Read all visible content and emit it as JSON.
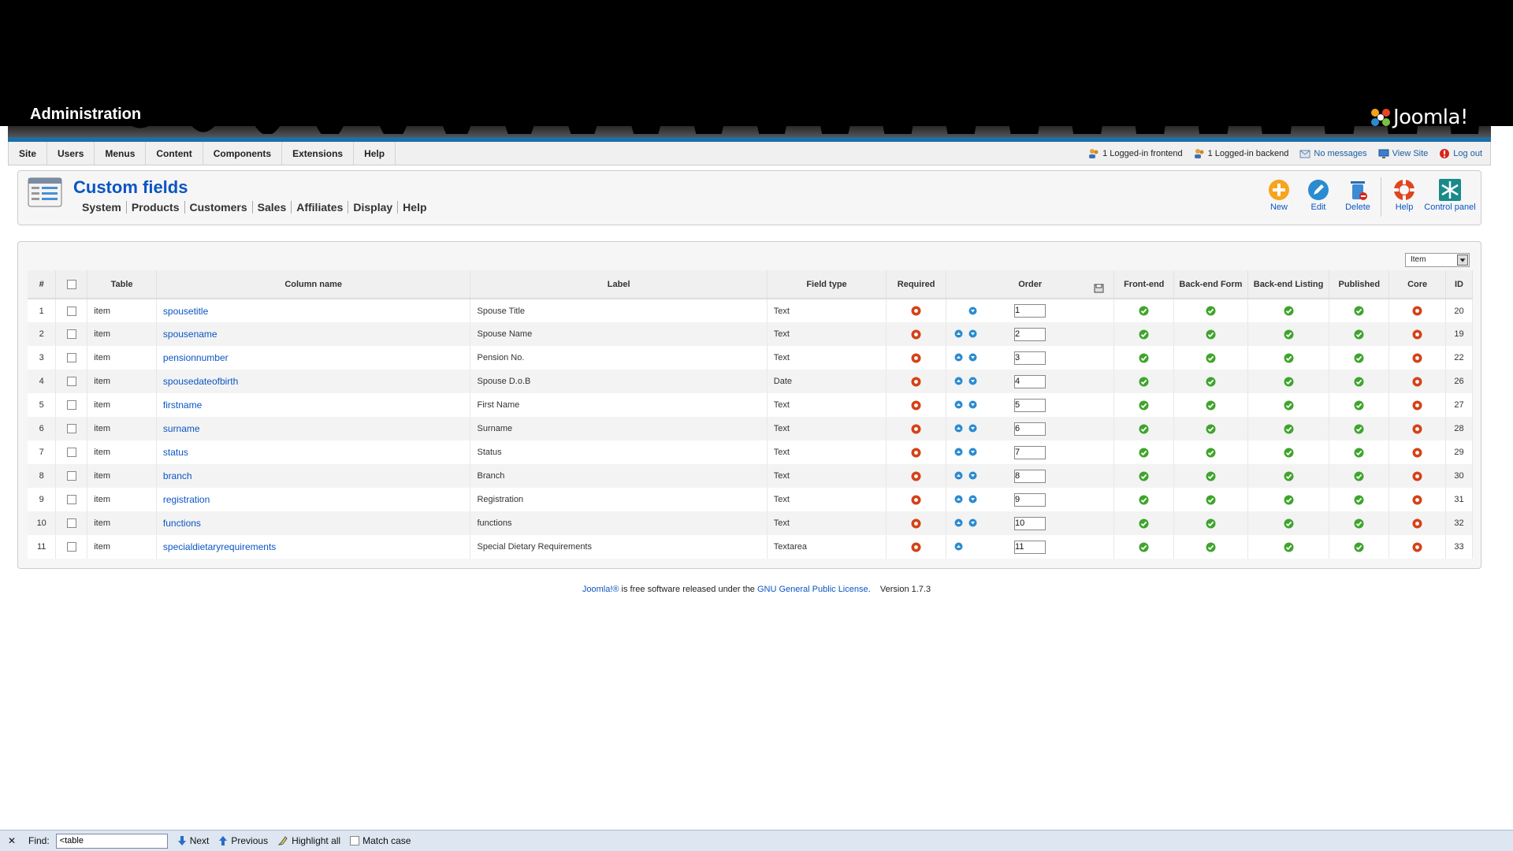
{
  "header": {
    "title": "Administration",
    "logo_text": "Joomla!"
  },
  "menu": [
    "Site",
    "Users",
    "Menus",
    "Content",
    "Components",
    "Extensions",
    "Help"
  ],
  "status": {
    "frontend": "1 Logged-in frontend",
    "backend": "1 Logged-in backend",
    "messages": "No messages",
    "view_site": "View Site",
    "logout": "Log out"
  },
  "page": {
    "title": "Custom fields",
    "submenu": [
      "System",
      "Products",
      "Customers",
      "Sales",
      "Affiliates",
      "Display",
      "Help"
    ]
  },
  "toolbar": {
    "new": "New",
    "edit": "Edit",
    "delete": "Delete",
    "help": "Help",
    "control_panel": "Control panel"
  },
  "filter": {
    "selected": "Item"
  },
  "table": {
    "headers": {
      "num": "#",
      "table": "Table",
      "column_name": "Column name",
      "label": "Label",
      "field_type": "Field type",
      "required": "Required",
      "order": "Order",
      "frontend": "Front-end",
      "backend_form": "Back-end Form",
      "backend_listing": "Back-end Listing",
      "published": "Published",
      "core": "Core",
      "id": "ID"
    },
    "rows": [
      {
        "num": "1",
        "table": "item",
        "column": "spousetitle",
        "label": "Spouse Title",
        "type": "Text",
        "order": "1",
        "id": "20",
        "up": false,
        "down": true
      },
      {
        "num": "2",
        "table": "item",
        "column": "spousename",
        "label": "Spouse Name",
        "type": "Text",
        "order": "2",
        "id": "19",
        "up": true,
        "down": true
      },
      {
        "num": "3",
        "table": "item",
        "column": "pensionnumber",
        "label": "Pension No.",
        "type": "Text",
        "order": "3",
        "id": "22",
        "up": true,
        "down": true
      },
      {
        "num": "4",
        "table": "item",
        "column": "spousedateofbirth",
        "label": "Spouse D.o.B",
        "type": "Date",
        "order": "4",
        "id": "26",
        "up": true,
        "down": true
      },
      {
        "num": "5",
        "table": "item",
        "column": "firstname",
        "label": "First Name",
        "type": "Text",
        "order": "5",
        "id": "27",
        "up": true,
        "down": true
      },
      {
        "num": "6",
        "table": "item",
        "column": "surname",
        "label": "Surname",
        "type": "Text",
        "order": "6",
        "id": "28",
        "up": true,
        "down": true
      },
      {
        "num": "7",
        "table": "item",
        "column": "status",
        "label": "Status",
        "type": "Text",
        "order": "7",
        "id": "29",
        "up": true,
        "down": true
      },
      {
        "num": "8",
        "table": "item",
        "column": "branch",
        "label": "Branch",
        "type": "Text",
        "order": "8",
        "id": "30",
        "up": true,
        "down": true
      },
      {
        "num": "9",
        "table": "item",
        "column": "registration",
        "label": "Registration",
        "type": "Text",
        "order": "9",
        "id": "31",
        "up": true,
        "down": true
      },
      {
        "num": "10",
        "table": "item",
        "column": "functions",
        "label": "functions",
        "type": "Text",
        "order": "10",
        "id": "32",
        "up": true,
        "down": true
      },
      {
        "num": "11",
        "table": "item",
        "column": "specialdietaryrequirements",
        "label": "Special Dietary Requirements",
        "type": "Textarea",
        "order": "11",
        "id": "33",
        "up": true,
        "down": false
      }
    ]
  },
  "footer": {
    "joomla": "Joomla!®",
    "text": " is free software released under the ",
    "license": "GNU General Public License",
    "version": ".    Version 1.7.3"
  },
  "findbar": {
    "label": "Find:",
    "value": "<table",
    "next": "Next",
    "previous": "Previous",
    "highlight": "Highlight all",
    "match_case": "Match case"
  },
  "colors": {
    "accent_blue": "#1d6ea6",
    "link": "#0b55c4",
    "status_ok": "#3ea52c",
    "status_no": "#d44217"
  }
}
